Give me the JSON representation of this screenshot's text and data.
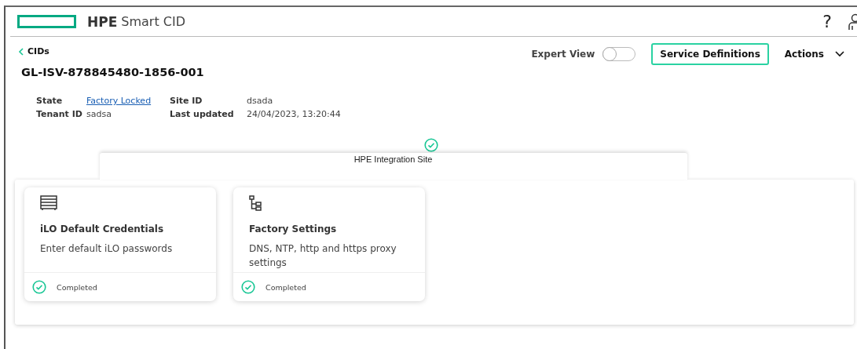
{
  "header": {
    "brand": "HPE",
    "product": "Smart CID",
    "help": "?"
  },
  "breadcrumb": {
    "label": "CIDs"
  },
  "title": "GL-ISV-878845480-1856-001",
  "details": [
    {
      "label": "State",
      "value": "Factory Locked",
      "link": true
    },
    {
      "label": "Site ID",
      "value": "dsada",
      "link": false
    },
    {
      "label": "Tenant ID",
      "value": "sadsa",
      "link": false
    },
    {
      "label": "Last updated",
      "value": "24/04/2023, 13:20:44",
      "link": false
    }
  ],
  "expert_view": {
    "label": "Expert View",
    "on": false
  },
  "buttons": {
    "service_definitions": "Service Definitions",
    "actions": "Actions"
  },
  "site": {
    "name": "HPE Integration Site",
    "completed": true
  },
  "cards": [
    {
      "title": "iLO Default Credentials",
      "description": "Enter default iLO passwords",
      "status": "Completed",
      "completed": true
    },
    {
      "title": "Factory Settings",
      "description": "DNS, NTP, http and https proxy settings",
      "status": "Completed",
      "completed": true
    }
  ]
}
